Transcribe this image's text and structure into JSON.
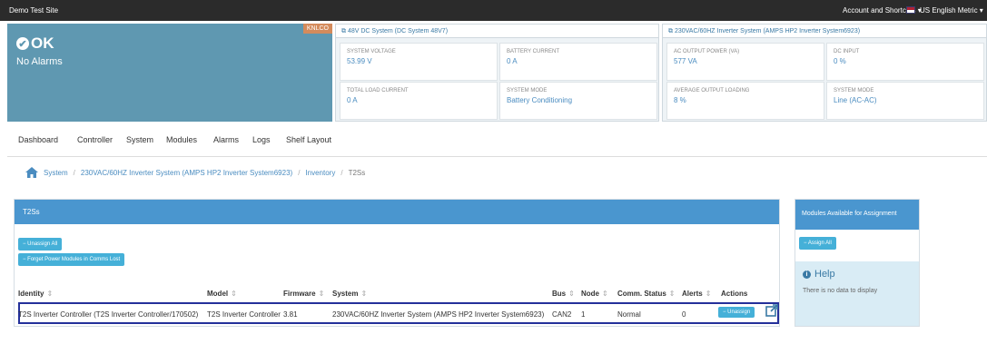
{
  "topbar": {
    "site_name": "Demo Test Site",
    "account_menu": "Account and Shortcuts ▾",
    "language_menu": "US English Metric ▾"
  },
  "status": {
    "tag": "KNLCO",
    "state": "OK",
    "alarms": "No Alarms",
    "icon": "check-circle-icon"
  },
  "dc_system": {
    "title": "⧉ 48V DC System (DC System 48V7)",
    "cells": [
      {
        "label": "SYSTEM VOLTAGE",
        "value": "53.99 V"
      },
      {
        "label": "BATTERY CURRENT",
        "value": "0 A"
      },
      {
        "label": "TOTAL LOAD CURRENT",
        "value": "0 A"
      },
      {
        "label": "SYSTEM MODE",
        "value": "Battery Conditioning"
      }
    ]
  },
  "inv_system": {
    "title": "⧉ 230VAC/60HZ Inverter System (AMPS HP2 Inverter System6923)",
    "cells": [
      {
        "label": "AC OUTPUT POWER (VA)",
        "value": "577 VA"
      },
      {
        "label": "DC INPUT",
        "value": "0 %"
      },
      {
        "label": "AVERAGE OUTPUT LOADING",
        "value": "8 %"
      },
      {
        "label": "SYSTEM MODE",
        "value": "Line (AC-AC)"
      }
    ]
  },
  "nav": [
    "Dashboard",
    "Controller",
    "System",
    "Modules",
    "Alarms",
    "Logs",
    "Shelf Layout"
  ],
  "breadcrumb": {
    "items": [
      "System",
      "230VAC/60HZ Inverter System (AMPS HP2 Inverter System6923)",
      "Inventory"
    ],
    "current": "T2Ss",
    "sep": "/"
  },
  "main": {
    "title": "T2Ss",
    "unassign_all": "− Unassign All",
    "forget": "− Forget Power Modules in Comms Lost",
    "columns": [
      "Identity",
      "Model",
      "Firmware",
      "System",
      "Bus",
      "Node",
      "Comm. Status",
      "Alerts",
      "Actions"
    ],
    "sort_glyph": "⇕",
    "row": {
      "identity": "T2S Inverter Controller (T2S Inverter Controller/170502)",
      "model": "T2S Inverter Controller",
      "firmware": "3.81",
      "system": "230VAC/60HZ Inverter System (AMPS HP2 Inverter System6923)",
      "bus": "CAN2",
      "node": "1",
      "comm_status": "Normal",
      "alerts": "0",
      "unassign": "− Unassign"
    }
  },
  "side": {
    "title": "Modules Available for Assignment",
    "assign_all": "− Assign All",
    "help_title": "Help",
    "help_text": "There is no data to display"
  },
  "colors": {
    "status_panel": "#5f98b1",
    "panel_header": "#4a96cf",
    "button": "#45b0d8",
    "highlight_border": "#24309a"
  }
}
